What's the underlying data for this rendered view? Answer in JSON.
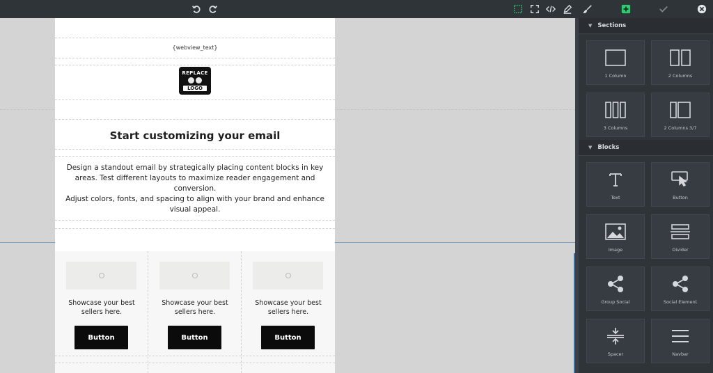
{
  "toolbar": {
    "left": [
      {
        "name": "undo-icon"
      },
      {
        "name": "redo-icon"
      }
    ],
    "right": [
      {
        "name": "select-outline-icon",
        "active": true
      },
      {
        "name": "fullscreen-icon"
      },
      {
        "name": "code-icon"
      },
      {
        "name": "edit-pen-icon"
      },
      {
        "name": "brush-icon"
      },
      {
        "name": "add-plus-icon",
        "accent": "#2ecc71"
      },
      {
        "name": "check-icon"
      },
      {
        "name": "close-icon"
      }
    ]
  },
  "email": {
    "webview": "{webview_text}",
    "logo": {
      "top": "REPLACE",
      "bottom": "LOGO"
    },
    "headline": "Start customizing your email",
    "paragraph1": "Design a standout email by strategically placing content blocks in key areas. Test different layouts to maximize reader engagement and conversion.",
    "paragraph2": "Adjust colors, fonts, and spacing to align with your brand and enhance visual appeal.",
    "cards": [
      {
        "text": "Showcase your best sellers here.",
        "button": "Button"
      },
      {
        "text": "Showcase your best sellers here.",
        "button": "Button"
      },
      {
        "text": "Showcase your best sellers here.",
        "button": "Button"
      }
    ]
  },
  "panel": {
    "sections_title": "Sections",
    "sections": [
      {
        "label": "1 Column",
        "icon": "one-column-icon"
      },
      {
        "label": "2 Columns",
        "icon": "two-columns-icon"
      },
      {
        "label": "3 Columns",
        "icon": "three-columns-icon"
      },
      {
        "label": "2 Columns 3/7",
        "icon": "two-columns-37-icon"
      }
    ],
    "blocks_title": "Blocks",
    "blocks": [
      {
        "label": "Text",
        "icon": "text-icon"
      },
      {
        "label": "Button",
        "icon": "button-pointer-icon"
      },
      {
        "label": "Image",
        "icon": "image-icon"
      },
      {
        "label": "Divider",
        "icon": "divider-icon"
      },
      {
        "label": "Group Social",
        "icon": "share-icon"
      },
      {
        "label": "Social Element",
        "icon": "share-icon"
      },
      {
        "label": "Spacer",
        "icon": "spacer-icon"
      },
      {
        "label": "Navbar",
        "icon": "navbar-icon"
      }
    ]
  },
  "colors": {
    "toolbar_bg": "#2f3439",
    "accent": "#2ecc71",
    "canvas_bg": "#d4d4d4",
    "email_bg": "#ffffff",
    "button_bg": "#0b0b0b"
  }
}
